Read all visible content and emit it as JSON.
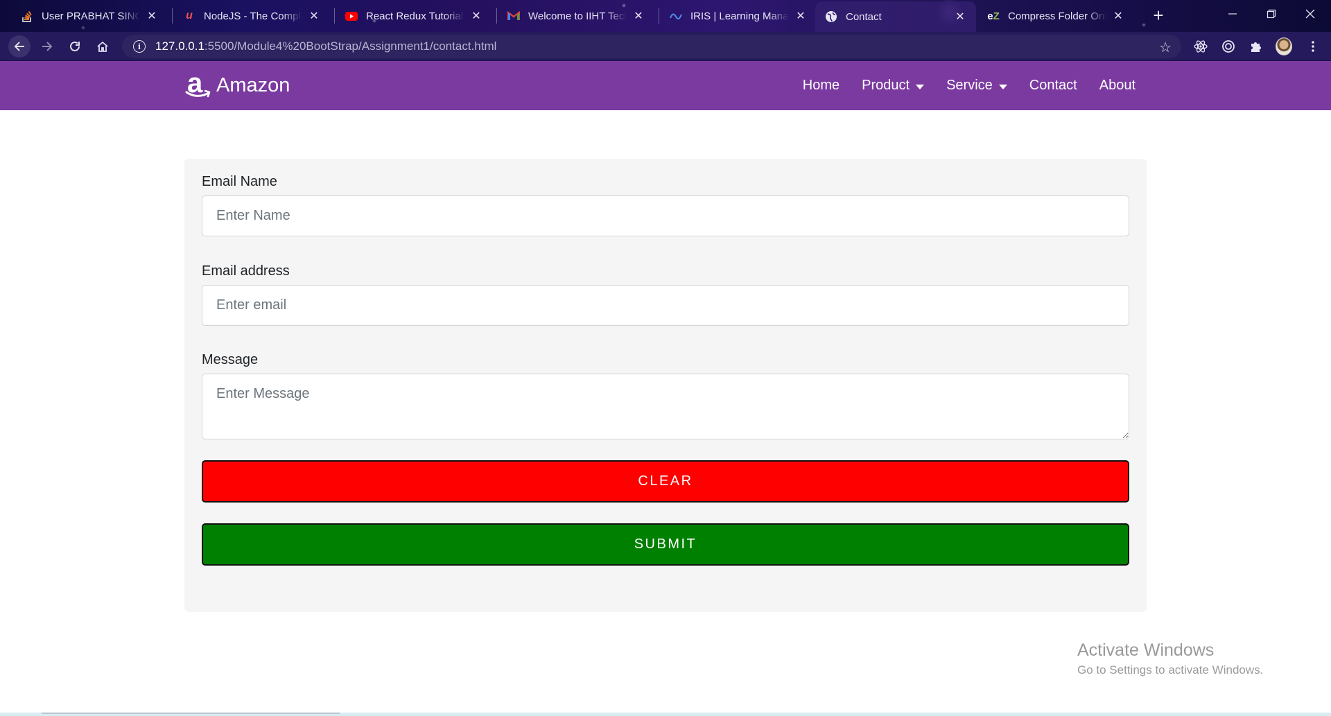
{
  "browser": {
    "tabs": [
      {
        "title": "User PRABHAT SINGH",
        "favicon": "stackoverflow-icon",
        "color": "#f48024",
        "glyph": "≡"
      },
      {
        "title": "NodeJS - The Complete",
        "favicon": "udemy-icon",
        "color": "#ec5252",
        "glyph": "u"
      },
      {
        "title": "React Redux Tutorials -",
        "favicon": "youtube-icon",
        "color": "#ff0000",
        "glyph": "▶"
      },
      {
        "title": "Welcome to IIHT Techa",
        "favicon": "gmail-icon",
        "color": "#ea4335",
        "glyph": "M"
      },
      {
        "title": "IRIS | Learning Manage",
        "favicon": "iris-icon",
        "color": "#4f8fe8",
        "glyph": "≈"
      },
      {
        "title": "Contact",
        "favicon": "globe-icon",
        "color": "#e7e5f3",
        "glyph": "◍"
      },
      {
        "title": "Compress Folder Onlin",
        "favicon": "ezyzip-icon",
        "color": "#8bc34a",
        "glyph": "eZ"
      }
    ],
    "active_tab_index": 5,
    "url_host": "127.0.0.1",
    "url_path": ":5500/Module4%20BootStrap/Assignment1/contact.html"
  },
  "site": {
    "brand": "Amazon",
    "brand_logo_letter": "a",
    "nav": {
      "home": "Home",
      "product": "Product",
      "service": "Service",
      "contact": "Contact",
      "about": "About"
    }
  },
  "form": {
    "name_label": "Email Name",
    "name_placeholder": "Enter Name",
    "email_label": "Email address",
    "email_placeholder": "Enter email",
    "message_label": "Message",
    "message_placeholder": "Enter Message",
    "clear_label": "CLEAR",
    "submit_label": "SUBMIT"
  },
  "watermark": {
    "title": "Activate Windows",
    "subtitle": "Go to Settings to activate Windows."
  },
  "colors": {
    "navbar": "#7b3aa0",
    "clear_button": "#ff0000",
    "submit_button": "#008000",
    "card": "#f5f5f5"
  }
}
